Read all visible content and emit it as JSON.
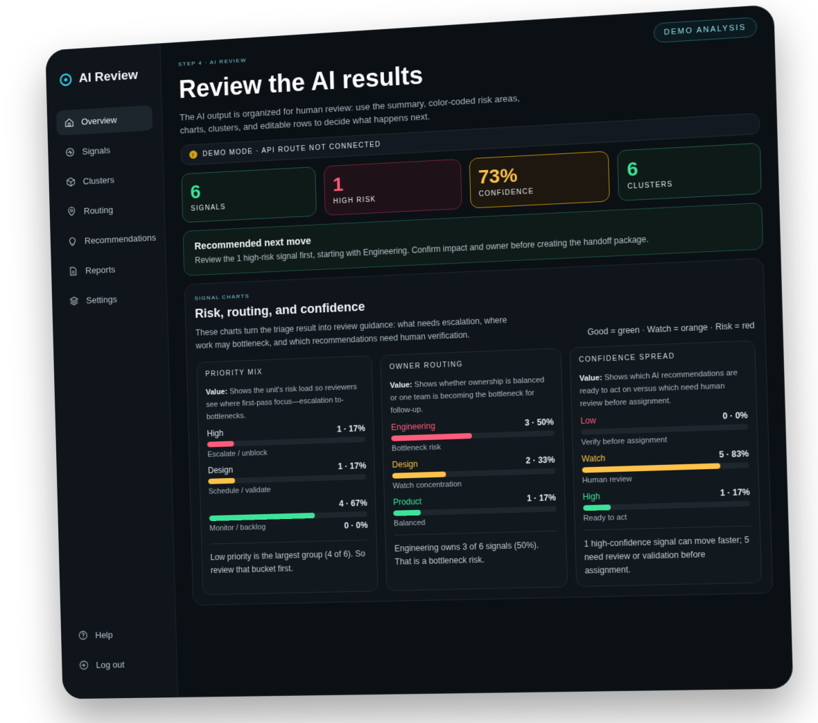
{
  "app": {
    "name": "AI Review"
  },
  "sidebar": {
    "items": [
      {
        "label": "Overview",
        "icon": "home-icon",
        "active": true
      },
      {
        "label": "Signals",
        "icon": "signal-icon"
      },
      {
        "label": "Clusters",
        "icon": "cube-icon"
      },
      {
        "label": "Routing",
        "icon": "route-icon"
      },
      {
        "label": "Recommendations",
        "icon": "lightbulb-icon"
      },
      {
        "label": "Reports",
        "icon": "document-icon"
      },
      {
        "label": "Settings",
        "icon": "layers-icon"
      }
    ],
    "bottom": [
      {
        "label": "Help",
        "icon": "help-icon"
      },
      {
        "label": "Log out",
        "icon": "logout-icon"
      }
    ]
  },
  "header": {
    "badge": "DEMO ANALYSIS",
    "step": "STEP 4 · AI REVIEW",
    "title": "Review the AI results",
    "subtitle": "The AI output is organized for human review: use the summary, color-coded risk areas, charts, clusters, and editable rows to decide what happens next."
  },
  "mode_bar": {
    "label": "DEMO MODE · API ROUTE NOT CONNECTED"
  },
  "stats": [
    {
      "value": "6",
      "label": "SIGNALS"
    },
    {
      "value": "1",
      "label": "HIGH RISK"
    },
    {
      "value": "73%",
      "label": "CONFIDENCE"
    },
    {
      "value": "6",
      "label": "CLUSTERS"
    }
  ],
  "recommendation": {
    "title": "Recommended next move",
    "text": "Review the 1 high-risk signal first, starting with Engineering. Confirm impact and owner before creating the handoff package."
  },
  "charts": {
    "eyebrow": "SIGNAL CHARTS",
    "title": "Risk, routing, and confidence",
    "description": "These charts turn the triage result into review guidance: what needs escalation, where work may bottleneck, and which recommendations need human verification.",
    "legend": "Good = green · Watch = orange · Risk = red",
    "value_prefix": "Value:",
    "panels": [
      {
        "title": "PRIORITY MIX",
        "value_text": "Shows the unit's risk load so reviewers see where first-pass focus—escalation to-bottlenecks.",
        "rows": [
          {
            "label": "High",
            "metric": "1 · 17%",
            "fraction": 0.17,
            "color": "#ff5c7a",
            "note": "Escalate / unblock"
          },
          {
            "label": "Design",
            "metric": "1 · 17%",
            "fraction": 0.17,
            "color": "#ffc24a",
            "note": "Schedule / validate"
          },
          {
            "label": "",
            "metric": "4 · 67%",
            "fraction": 0.67,
            "color": "#3ee39a",
            "note": "Monitor / backlog",
            "extra_metric": "0 · 0%"
          }
        ],
        "footer": "Low priority is the largest group (4 of 6). So review that bucket first."
      },
      {
        "title": "OWNER ROUTING",
        "value_text": "Shows whether ownership is balanced or one team is becoming the bottleneck for follow-up.",
        "rows": [
          {
            "label": "Engineering",
            "metric": "3 · 50%",
            "fraction": 0.5,
            "color": "#ff5c7a",
            "note": "Bottleneck risk"
          },
          {
            "label": "Design",
            "metric": "2 · 33%",
            "fraction": 0.33,
            "color": "#ffc24a",
            "note": "Watch concentration"
          },
          {
            "label": "Product",
            "metric": "1 · 17%",
            "fraction": 0.17,
            "color": "#3ee39a",
            "note": "Balanced"
          }
        ],
        "footer": "Engineering owns 3 of 6 signals (50%). That is a bottleneck risk."
      },
      {
        "title": "CONFIDENCE SPREAD",
        "value_text": "Shows which AI recommendations are ready to act on versus which need human review before assignment.",
        "rows": [
          {
            "label": "Low",
            "metric": "0 · 0%",
            "fraction": 0.0,
            "color": "#ff5c7a",
            "note": "Verify before assignment"
          },
          {
            "label": "Watch",
            "metric": "5 · 83%",
            "fraction": 0.83,
            "color": "#ffc24a",
            "note": "Human review"
          },
          {
            "label": "High",
            "metric": "1 · 17%",
            "fraction": 0.17,
            "color": "#3ee39a",
            "note": "Ready to act"
          }
        ],
        "footer": "1 high-confidence signal can move faster; 5 need review or validation before assignment."
      }
    ]
  }
}
